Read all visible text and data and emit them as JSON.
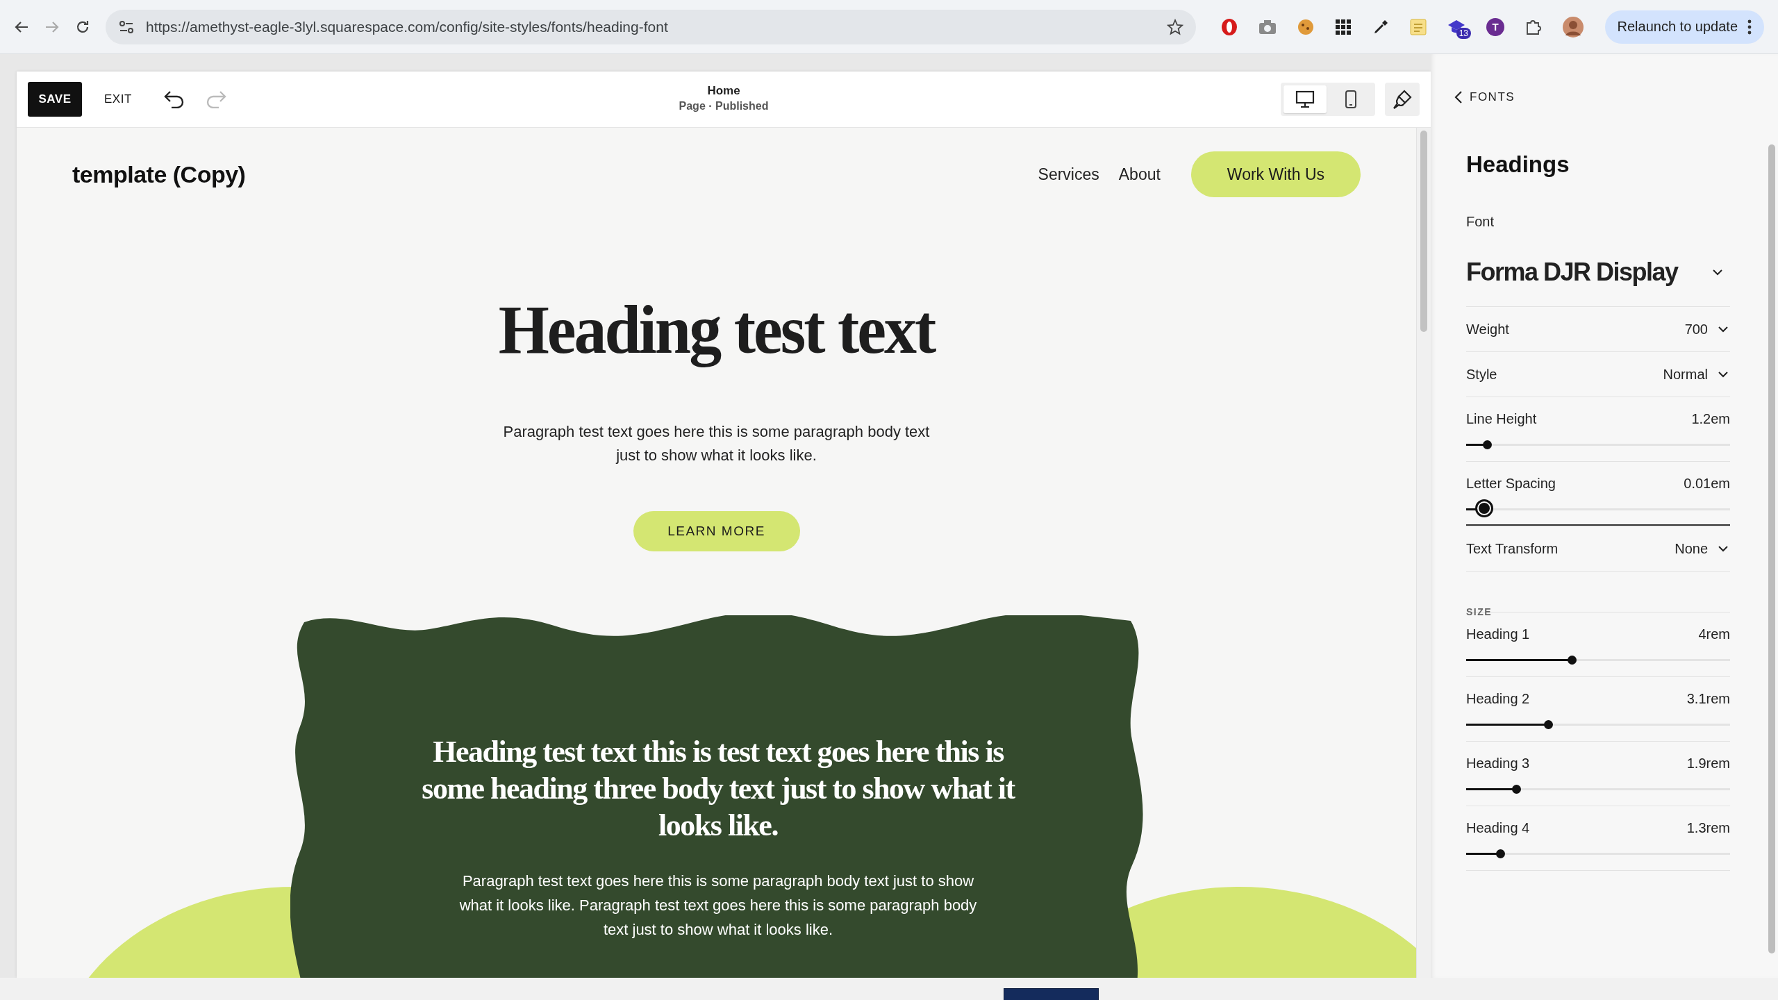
{
  "browser": {
    "url": "https://amethyst-eagle-3lyl.squarespace.com/config/site-styles/fonts/heading-font",
    "extension_badge": "13",
    "profile_letter": "T",
    "relaunch": "Relaunch to update"
  },
  "editor": {
    "save": "SAVE",
    "exit": "EXIT",
    "page_title": "Home",
    "page_status": "Page · Published",
    "devices": [
      {
        "kind": "desktop",
        "selected": true
      },
      {
        "kind": "mobile",
        "selected": false
      }
    ]
  },
  "site": {
    "logo": "template (Copy)",
    "nav": [
      "Services",
      "About"
    ],
    "cta": "Work With Us",
    "hero_heading": "Heading test text",
    "hero_text": "Paragraph test text goes here this is some paragraph body text just to show what it looks like.",
    "hero_button": "LEARN MORE",
    "card_heading": "Heading test text this is test text goes here this is some heading three body text just to show what it looks like.",
    "card_text": "Paragraph test text goes here this is some paragraph body text just to show what it looks like. Paragraph test text goes here this is some paragraph body text just to show what it looks like."
  },
  "panel": {
    "back": "FONTS",
    "title": "Headings",
    "font_label": "Font",
    "font_value": "Forma DJR Display",
    "rows": [
      {
        "kind": "dropdown",
        "label": "Weight",
        "value": "700"
      },
      {
        "kind": "dropdown",
        "label": "Style",
        "value": "Normal"
      },
      {
        "kind": "slider",
        "label": "Line Height",
        "value": "1.2em",
        "level": 0.08,
        "focused": false
      },
      {
        "kind": "slider",
        "label": "Letter Spacing",
        "value": "0.01em",
        "level": 0.07,
        "focused": true
      },
      {
        "kind": "dropdown",
        "label": "Text Transform",
        "value": "None"
      }
    ],
    "size_label": "SIZE",
    "sizes": [
      {
        "label": "Heading 1",
        "value": "4rem",
        "level": 0.4
      },
      {
        "label": "Heading 2",
        "value": "3.1rem",
        "level": 0.31
      },
      {
        "label": "Heading 3",
        "value": "1.9rem",
        "level": 0.19
      },
      {
        "label": "Heading 4",
        "value": "1.3rem",
        "level": 0.13
      }
    ]
  }
}
